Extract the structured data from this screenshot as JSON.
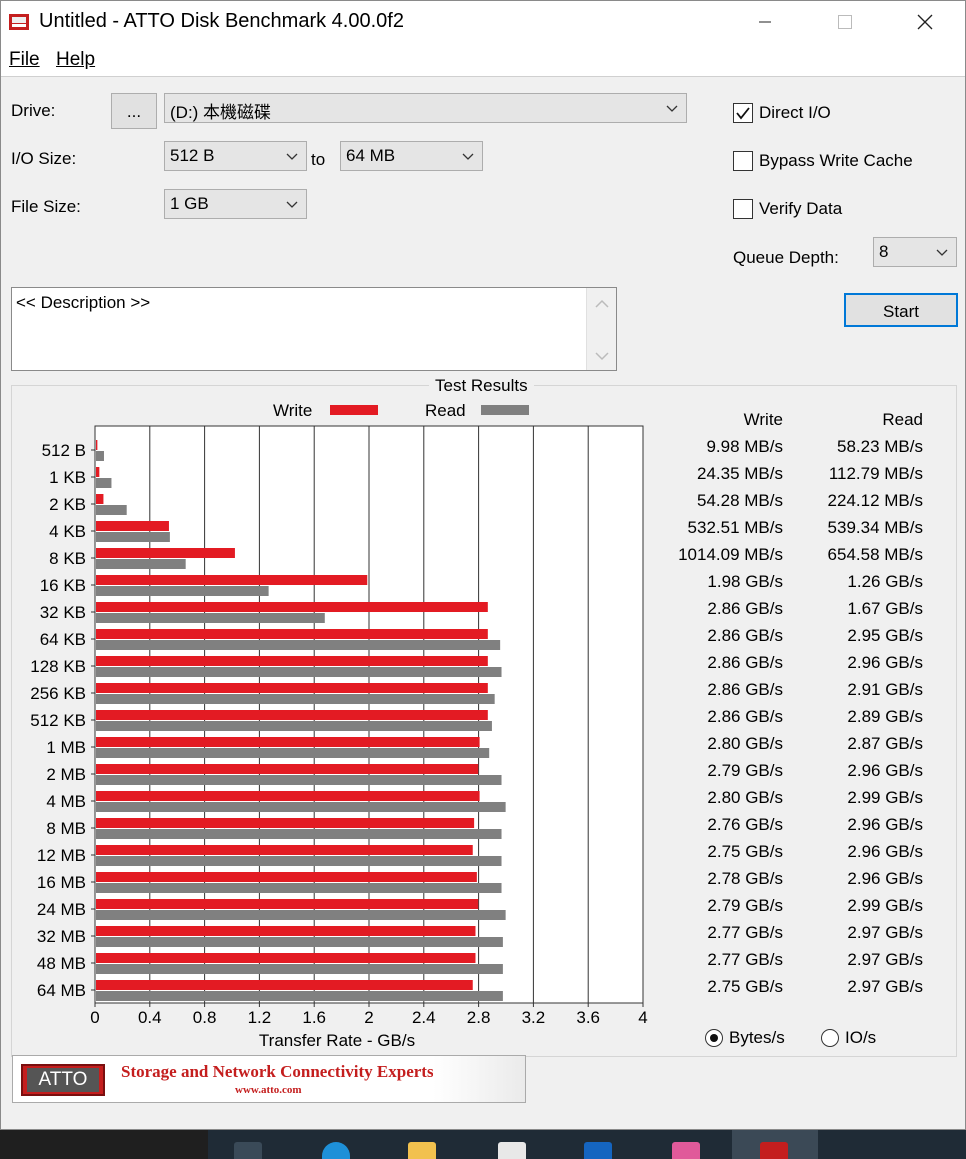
{
  "window": {
    "title": "Untitled - ATTO Disk Benchmark 4.00.0f2"
  },
  "menu": {
    "file": "File",
    "help": "Help"
  },
  "drive": {
    "label": "Drive:",
    "browse": "...",
    "value": "(D:) 本機磁碟"
  },
  "io_size": {
    "label": "I/O Size:",
    "from": "512 B",
    "to_word": "to",
    "to": "64 MB"
  },
  "file_size": {
    "label": "File Size:",
    "value": "1 GB"
  },
  "options": {
    "direct_io": {
      "label": "Direct I/O",
      "checked": true
    },
    "bypass_write_cache": {
      "label": "Bypass Write Cache",
      "checked": false
    },
    "verify_data": {
      "label": "Verify Data",
      "checked": false
    },
    "queue_depth_label": "Queue Depth:",
    "queue_depth": "8"
  },
  "start_label": "Start",
  "description": "<< Description >>",
  "results": {
    "title": "Test Results",
    "legend_write": "Write",
    "legend_read": "Read",
    "col_write": "Write",
    "col_read": "Read",
    "rows": [
      {
        "size": "512 B",
        "write": "9.98 MB/s",
        "read": "58.23 MB/s"
      },
      {
        "size": "1 KB",
        "write": "24.35 MB/s",
        "read": "112.79 MB/s"
      },
      {
        "size": "2 KB",
        "write": "54.28 MB/s",
        "read": "224.12 MB/s"
      },
      {
        "size": "4 KB",
        "write": "532.51 MB/s",
        "read": "539.34 MB/s"
      },
      {
        "size": "8 KB",
        "write": "1014.09 MB/s",
        "read": "654.58 MB/s"
      },
      {
        "size": "16 KB",
        "write": "1.98 GB/s",
        "read": "1.26 GB/s"
      },
      {
        "size": "32 KB",
        "write": "2.86 GB/s",
        "read": "1.67 GB/s"
      },
      {
        "size": "64 KB",
        "write": "2.86 GB/s",
        "read": "2.95 GB/s"
      },
      {
        "size": "128 KB",
        "write": "2.86 GB/s",
        "read": "2.96 GB/s"
      },
      {
        "size": "256 KB",
        "write": "2.86 GB/s",
        "read": "2.91 GB/s"
      },
      {
        "size": "512 KB",
        "write": "2.86 GB/s",
        "read": "2.89 GB/s"
      },
      {
        "size": "1 MB",
        "write": "2.80 GB/s",
        "read": "2.87 GB/s"
      },
      {
        "size": "2 MB",
        "write": "2.79 GB/s",
        "read": "2.96 GB/s"
      },
      {
        "size": "4 MB",
        "write": "2.80 GB/s",
        "read": "2.99 GB/s"
      },
      {
        "size": "8 MB",
        "write": "2.76 GB/s",
        "read": "2.96 GB/s"
      },
      {
        "size": "12 MB",
        "write": "2.75 GB/s",
        "read": "2.96 GB/s"
      },
      {
        "size": "16 MB",
        "write": "2.78 GB/s",
        "read": "2.96 GB/s"
      },
      {
        "size": "24 MB",
        "write": "2.79 GB/s",
        "read": "2.99 GB/s"
      },
      {
        "size": "32 MB",
        "write": "2.77 GB/s",
        "read": "2.97 GB/s"
      },
      {
        "size": "48 MB",
        "write": "2.77 GB/s",
        "read": "2.97 GB/s"
      },
      {
        "size": "64 MB",
        "write": "2.75 GB/s",
        "read": "2.97 GB/s"
      }
    ],
    "units": {
      "bytes": "Bytes/s",
      "io": "IO/s",
      "selected": "bytes"
    }
  },
  "chart_data": {
    "type": "bar",
    "orientation": "horizontal",
    "categories": [
      "512 B",
      "1 KB",
      "2 KB",
      "4 KB",
      "8 KB",
      "16 KB",
      "32 KB",
      "64 KB",
      "128 KB",
      "256 KB",
      "512 KB",
      "1 MB",
      "2 MB",
      "4 MB",
      "8 MB",
      "12 MB",
      "16 MB",
      "24 MB",
      "32 MB",
      "48 MB",
      "64 MB"
    ],
    "series": [
      {
        "name": "Write",
        "color": "#e31b23",
        "values": [
          0.00998,
          0.02435,
          0.05428,
          0.53251,
          1.01409,
          1.98,
          2.86,
          2.86,
          2.86,
          2.86,
          2.86,
          2.8,
          2.79,
          2.8,
          2.76,
          2.75,
          2.78,
          2.79,
          2.77,
          2.77,
          2.75
        ]
      },
      {
        "name": "Read",
        "color": "#808080",
        "values": [
          0.05823,
          0.11279,
          0.22412,
          0.53934,
          0.65458,
          1.26,
          1.67,
          2.95,
          2.96,
          2.91,
          2.89,
          2.87,
          2.96,
          2.99,
          2.96,
          2.96,
          2.96,
          2.99,
          2.97,
          2.97,
          2.97
        ]
      }
    ],
    "xlabel": "Transfer Rate - GB/s",
    "xlim": [
      0,
      4
    ],
    "xticks": [
      "0",
      "0.4",
      "0.8",
      "1.2",
      "1.6",
      "2",
      "2.4",
      "2.8",
      "3.2",
      "3.6",
      "4"
    ],
    "grid": true,
    "legend": "top"
  },
  "banner": {
    "logo": "ATTO",
    "tagline": "Storage and Network Connectivity Experts",
    "url": "www.atto.com"
  },
  "colors": {
    "write": "#e31b23",
    "read": "#808080",
    "taskbar": "#1f2b36"
  }
}
